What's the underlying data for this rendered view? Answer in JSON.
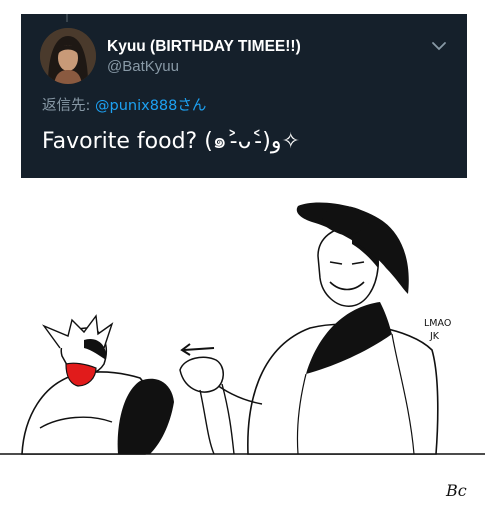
{
  "tweet": {
    "display_name": "Kyuu (BIRTHDAY TIMEE!!)",
    "handle": "@BatKyuu",
    "reply_prefix": "返信先: ",
    "reply_mention": "@punix888",
    "reply_suffix": "さん",
    "text": "Favorite food? (๑˃̵ᴗ˂̵)و✧",
    "menu_icon": "chevron-down-icon",
    "colors": {
      "background": "#15202b",
      "name": "#ffffff",
      "secondary": "#8899a6",
      "link": "#1da1f2"
    }
  },
  "artwork": {
    "speech_line1": "LMAO",
    "speech_line2": "JK",
    "signature": "Bc"
  }
}
